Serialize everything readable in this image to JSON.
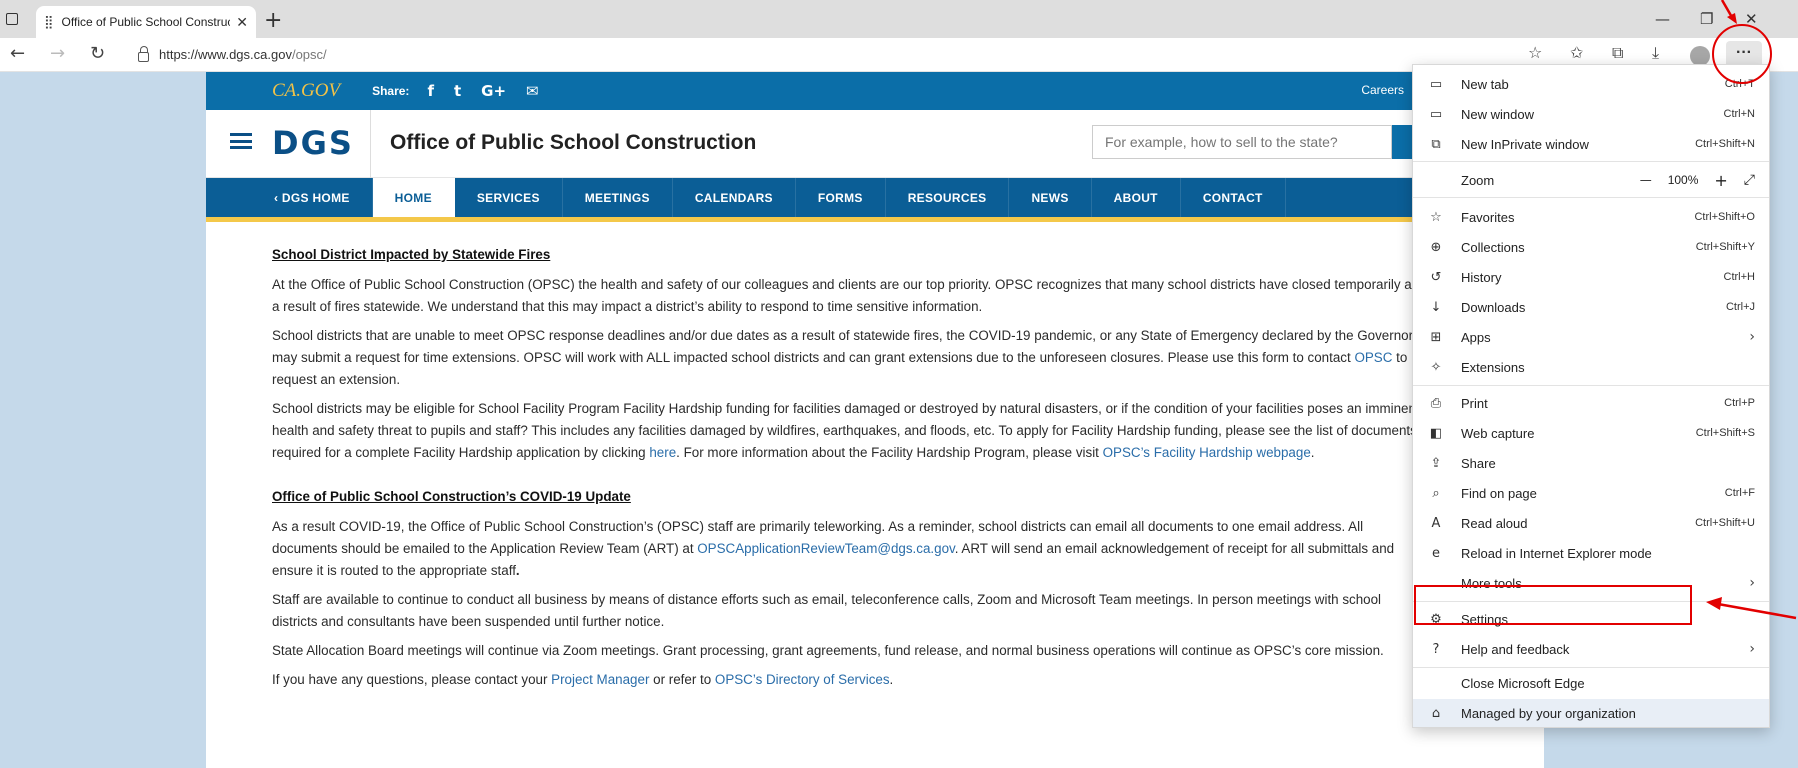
{
  "browser": {
    "tab_title": "Office of Public School Construct",
    "url_host": "https://www.dgs.ca.gov",
    "url_path": "/opsc/"
  },
  "site": {
    "cagov": "CA.GOV",
    "share_label": "Share:",
    "social_icons": [
      "f",
      "t",
      "G+",
      "✉"
    ],
    "careers": "Careers",
    "logo": "DGS",
    "title": "Office of Public School Construction",
    "search_placeholder": "For example, how to sell to the state?",
    "nav": [
      "‹  DGS HOME",
      "HOME",
      "SERVICES",
      "MEETINGS",
      "CALENDARS",
      "FORMS",
      "RESOURCES",
      "NEWS",
      "ABOUT",
      "CONTACT"
    ],
    "active_nav": "HOME",
    "content": {
      "h1": "School District Impacted by Statewide Fires",
      "p1": "At the Office of Public School Construction (OPSC) the health and safety of our colleagues and clients are our top priority. OPSC recognizes that many school districts have closed temporarily as a result of fires statewide. We understand that this may impact a district’s ability to respond to time sensitive information.",
      "p2a": "School districts that are unable to meet OPSC response deadlines and/or due dates as a result of statewide fires, the COVID-19 pandemic, or any State of Emergency declared by the Governor, may submit a request for time extensions. OPSC will work with ALL impacted school districts and can grant extensions due to the unforeseen closures. Please use this form to contact ",
      "p2_link": "OPSC",
      "p2b": " to request an extension.",
      "p3a": "School districts may be eligible for School Facility Program Facility Hardship funding for facilities damaged or destroyed by natural disasters, or if the condition of your facilities poses an imminent health and safety threat to pupils and staff? This includes any facilities damaged by wildfires, earthquakes, and floods, etc. To apply for Facility Hardship funding, please see the list of documents required for a complete Facility Hardship application by clicking ",
      "p3_link1": "here",
      "p3b": ".  For more information about the Facility Hardship Program, please visit ",
      "p3_link2": "OPSC’s Facility Hardship webpage",
      "p3c": ".",
      "h2": "Office of Public School Construction’s COVID-19 Update",
      "p4a": "As a result COVID-19, the Office of Public School Construction’s (OPSC) staff are primarily teleworking. As a reminder, school districts can email all documents to one email address. All documents should be emailed to the Application Review Team (ART) at ",
      "p4_link": "OPSCApplicationReviewTeam@dgs.ca.gov",
      "p4b": ". ART will send an email acknowledgement of receipt for all submittals and ensure it is routed to the appropriate staff",
      "p4c": ".",
      "p5": "Staff are available to continue to conduct all business by means of distance efforts such as email, teleconference calls, Zoom and Microsoft Team meetings. In person meetings with school districts and consultants have been suspended until further notice.",
      "p6": "State Allocation Board meetings will continue via Zoom meetings. Grant processing, grant agreements, fund release, and normal business operations will continue as OPSC’s core mission.",
      "p7a": "If you have any questions, please contact your ",
      "p7_link1": "Project Manager",
      "p7b": " or refer to ",
      "p7_link2": "OPSC’s Directory of Services",
      "p7c": "."
    }
  },
  "menu": {
    "items": [
      {
        "icon": "▭",
        "label": "New tab",
        "shortcut": "Ctrl+T"
      },
      {
        "icon": "▭",
        "label": "New window",
        "shortcut": "Ctrl+N"
      },
      {
        "icon": "⧉",
        "label": "New InPrivate window",
        "shortcut": "Ctrl+Shift+N"
      },
      {
        "icon": "",
        "label": "Zoom",
        "shortcut": ""
      },
      {
        "icon": "☆",
        "label": "Favorites",
        "shortcut": "Ctrl+Shift+O"
      },
      {
        "icon": "⊕",
        "label": "Collections",
        "shortcut": "Ctrl+Shift+Y"
      },
      {
        "icon": "↺",
        "label": "History",
        "shortcut": "Ctrl+H"
      },
      {
        "icon": "↓",
        "label": "Downloads",
        "shortcut": "Ctrl+J"
      },
      {
        "icon": "⊞",
        "label": "Apps",
        "shortcut": ""
      },
      {
        "icon": "✧",
        "label": "Extensions",
        "shortcut": ""
      },
      {
        "icon": "⎙",
        "label": "Print",
        "shortcut": "Ctrl+P"
      },
      {
        "icon": "◧",
        "label": "Web capture",
        "shortcut": "Ctrl+Shift+S"
      },
      {
        "icon": "⇪",
        "label": "Share",
        "shortcut": ""
      },
      {
        "icon": "⌕",
        "label": "Find on page",
        "shortcut": "Ctrl+F"
      },
      {
        "icon": "A",
        "label": "Read aloud",
        "shortcut": "Ctrl+Shift+U"
      },
      {
        "icon": "e",
        "label": "Reload in Internet Explorer mode",
        "shortcut": ""
      },
      {
        "icon": "",
        "label": "More tools",
        "shortcut": ""
      },
      {
        "icon": "⚙",
        "label": "Settings",
        "shortcut": ""
      },
      {
        "icon": "?",
        "label": "Help and feedback",
        "shortcut": ""
      },
      {
        "icon": "",
        "label": "Close Microsoft Edge",
        "shortcut": ""
      },
      {
        "icon": "⌂",
        "label": "Managed by your organization",
        "shortcut": ""
      }
    ],
    "zoom_value": "100%",
    "zoom_minus": "—",
    "zoom_plus": "+",
    "zoom_expand": "⤢"
  },
  "colors": {
    "annotation": "#e20000",
    "site_blue": "#0b6ea8",
    "nav_yellow": "#f4c84a"
  }
}
